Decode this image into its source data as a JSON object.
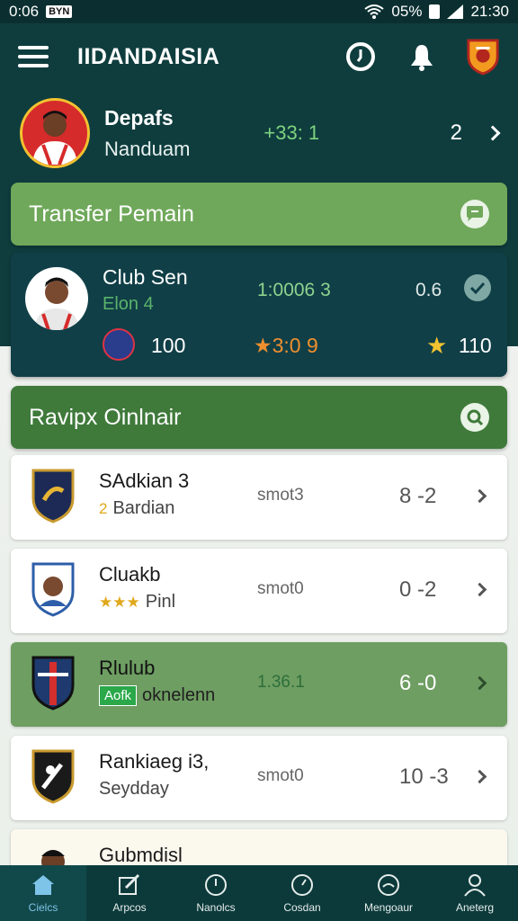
{
  "status_bar": {
    "time_left": "0:06",
    "chip": "BYN",
    "battery": "05%",
    "time_right": "21:30"
  },
  "app_bar": {
    "title": "IIDANDAISIA",
    "icons": [
      "menu-icon",
      "clock-icon",
      "bell-icon",
      "club-crest-icon"
    ]
  },
  "profile": {
    "name": "Depafs",
    "subtitle": "Nanduam",
    "score": "+33: 1",
    "count": "2"
  },
  "section_transfer": {
    "title": "Transfer Pemain",
    "icon": "chat-icon"
  },
  "featured_card": {
    "name": "Club Sen",
    "subtitle": "Elon 4",
    "score": "1:0006 3",
    "value": "0.6",
    "count": "100",
    "rating": "3:0 9",
    "total": "110"
  },
  "section_ranking": {
    "title": "Ravipx Oinlnair",
    "icon": "search-icon"
  },
  "list": [
    {
      "title": "SAdkian 3",
      "sub_prefix": "2",
      "sub": "Bardian",
      "stat": "smot3",
      "score": "8 -2",
      "crest_color": "#1c2a55"
    },
    {
      "title": "Cluakb",
      "sub_prefix": "",
      "sub": "Pinl",
      "stat": "smot0",
      "score": "0 -2",
      "crest_color": "#2d5ea8"
    },
    {
      "title": "Rlulub",
      "sub_prefix": "Aofk",
      "sub": "oknelenn",
      "stat": "1.36.1",
      "score": "6 -0",
      "crest_color": "#1e3a6e"
    },
    {
      "title": "Rankiaeg i3,",
      "sub_prefix": "",
      "sub": "Seydday",
      "stat": "smot0",
      "score": "10 -3",
      "crest_color": "#1a1a1a"
    },
    {
      "title": "Gubmdisl"
    }
  ],
  "bottom_nav": [
    {
      "label": "Cielcs",
      "icon": "home-icon"
    },
    {
      "label": "Arpcos",
      "icon": "edit-icon"
    },
    {
      "label": "Nanolcs",
      "icon": "clock-icon"
    },
    {
      "label": "Cosdan",
      "icon": "timer-icon"
    },
    {
      "label": "Mengoaur",
      "icon": "gauge-icon"
    },
    {
      "label": "Aneterg",
      "icon": "user-icon"
    }
  ],
  "colors": {
    "primary": "#0f3d3e",
    "accent_green": "#6fa85a",
    "dark_green": "#3f7a3b",
    "score_green": "#7ed37e",
    "active_nav": "#7ec3e8"
  }
}
